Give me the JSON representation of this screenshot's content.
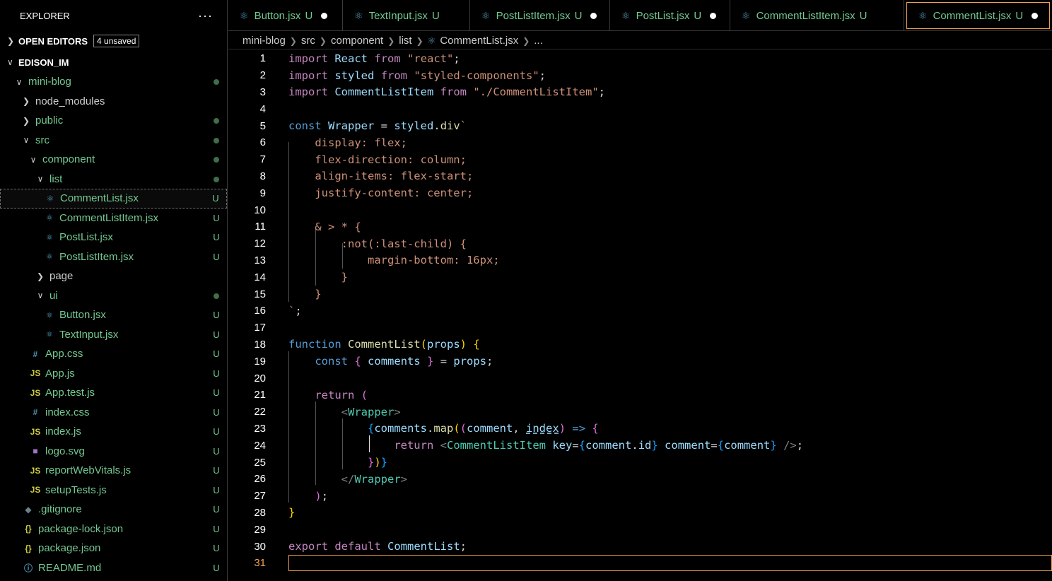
{
  "sidebar": {
    "title": "EXPLORER",
    "more": "···",
    "open_editors": {
      "label": "OPEN EDITORS",
      "badge": "4 unsaved"
    },
    "workspace": "EDISON_IM",
    "tree": [
      {
        "label": "mini-blog",
        "kind": "folder-open",
        "status": "dot"
      },
      {
        "label": "node_modules",
        "kind": "folder",
        "status": ""
      },
      {
        "label": "public",
        "kind": "folder",
        "status": "dot"
      },
      {
        "label": "src",
        "kind": "folder-open",
        "status": "dot"
      },
      {
        "label": "component",
        "kind": "folder-open",
        "status": "dot"
      },
      {
        "label": "list",
        "kind": "folder-open",
        "status": "dot"
      },
      {
        "label": "CommentList.jsx",
        "kind": "react",
        "status": "U"
      },
      {
        "label": "CommentListItem.jsx",
        "kind": "react",
        "status": "U"
      },
      {
        "label": "PostList.jsx",
        "kind": "react",
        "status": "U"
      },
      {
        "label": "PostListItem.jsx",
        "kind": "react",
        "status": "U"
      },
      {
        "label": "page",
        "kind": "folder",
        "status": ""
      },
      {
        "label": "ui",
        "kind": "folder-open",
        "status": "dot"
      },
      {
        "label": "Button.jsx",
        "kind": "react",
        "status": "U"
      },
      {
        "label": "TextInput.jsx",
        "kind": "react",
        "status": "U"
      },
      {
        "label": "App.css",
        "kind": "css",
        "status": "U"
      },
      {
        "label": "App.js",
        "kind": "js",
        "status": "U"
      },
      {
        "label": "App.test.js",
        "kind": "js",
        "status": "U"
      },
      {
        "label": "index.css",
        "kind": "css",
        "status": "U"
      },
      {
        "label": "index.js",
        "kind": "js",
        "status": "U"
      },
      {
        "label": "logo.svg",
        "kind": "svg",
        "status": "U"
      },
      {
        "label": "reportWebVitals.js",
        "kind": "js",
        "status": "U"
      },
      {
        "label": "setupTests.js",
        "kind": "js",
        "status": "U"
      },
      {
        "label": ".gitignore",
        "kind": "git",
        "status": "U"
      },
      {
        "label": "package-lock.json",
        "kind": "json",
        "status": "U"
      },
      {
        "label": "package.json",
        "kind": "json",
        "status": "U"
      },
      {
        "label": "README.md",
        "kind": "info",
        "status": "U"
      }
    ]
  },
  "tabs": [
    {
      "label": "Button.jsx",
      "status": "U",
      "dirty": true
    },
    {
      "label": "TextInput.jsx",
      "status": "U",
      "dirty": false
    },
    {
      "label": "PostListItem.jsx",
      "status": "U",
      "dirty": true
    },
    {
      "label": "PostList.jsx",
      "status": "U",
      "dirty": true
    },
    {
      "label": "CommentListItem.jsx",
      "status": "U",
      "dirty": false
    },
    {
      "label": "CommentList.jsx",
      "status": "U",
      "dirty": true
    }
  ],
  "breadcrumb": [
    "mini-blog",
    "src",
    "component",
    "list",
    "CommentList.jsx",
    "..."
  ],
  "editor": {
    "current_line": 31,
    "line_numbers": [
      "1",
      "2",
      "3",
      "4",
      "5",
      "6",
      "7",
      "8",
      "9",
      "10",
      "11",
      "12",
      "13",
      "14",
      "15",
      "16",
      "17",
      "18",
      "19",
      "20",
      "21",
      "22",
      "23",
      "24",
      "25",
      "26",
      "27",
      "28",
      "29",
      "30",
      "31"
    ]
  },
  "colors": {
    "accent": "#f0a050",
    "untracked": "#73c991",
    "react_icon": "#519aba",
    "background": "#000000"
  }
}
